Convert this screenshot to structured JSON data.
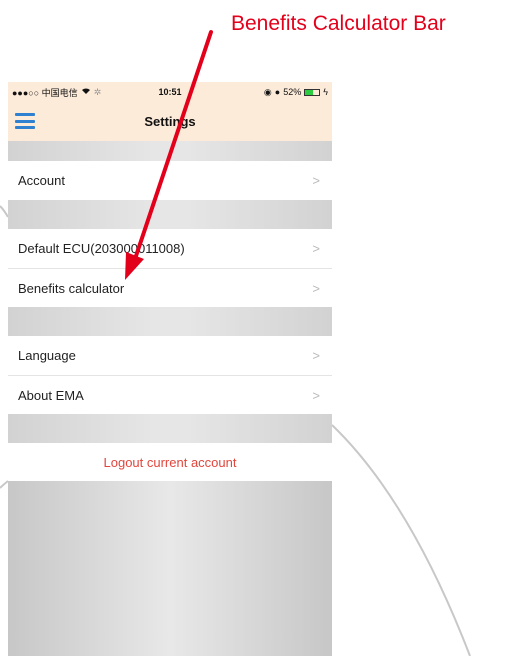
{
  "annotation": {
    "text": "Benefits Calculator Bar",
    "color": "#e3001b"
  },
  "status_bar": {
    "carrier": "●●●○○ 中国电信",
    "time": "10:51",
    "battery_percent": "52%",
    "battery_level": 0.52
  },
  "nav": {
    "title": "Settings",
    "menu_icon": "hamburger-menu-icon"
  },
  "sections": [
    {
      "items": [
        {
          "label": "Account"
        }
      ]
    },
    {
      "items": [
        {
          "label": "Default ECU(203000011008)"
        },
        {
          "label": "Benefits calculator"
        }
      ]
    },
    {
      "items": [
        {
          "label": "Language"
        },
        {
          "label": "About EMA"
        }
      ]
    }
  ],
  "chevron": ">",
  "logout_label": "Logout current account",
  "colors": {
    "nav_bg": "#fdebd9",
    "accent": "#2f80d1",
    "logout": "#e2463c",
    "arrow": "#e3001b"
  }
}
